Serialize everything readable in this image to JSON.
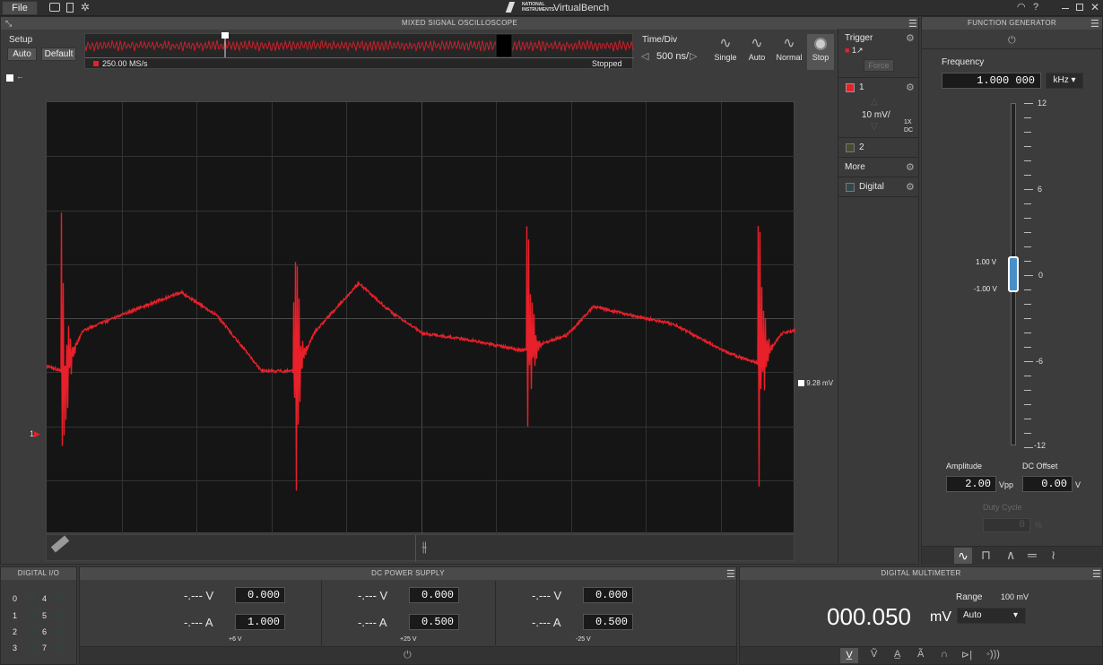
{
  "window": {
    "title": "VirtualBench",
    "brand": "NATIONAL INSTRUMENTS",
    "menu_file": "File"
  },
  "scope": {
    "header": "MIXED SIGNAL OSCILLOSCOPE",
    "setup_label": "Setup",
    "auto_label": "Auto",
    "default_label": "Default",
    "sample_rate": "250.00 MS/s",
    "state": "Stopped",
    "timediv_label": "Time/Div",
    "timediv_value": "500 ns/",
    "modes": [
      "Single",
      "Auto",
      "Normal",
      "Stop"
    ],
    "trigger_level": "9.28 mV",
    "channel_marker": "1"
  },
  "channels": {
    "trigger_label": "Trigger",
    "trigger_source": "1",
    "force_label": "Force",
    "ch1_label": "1",
    "ch1_scale": "10 mV/",
    "ch1_probe": "1X",
    "ch1_coupling": "DC",
    "ch2_label": "2",
    "more_label": "More",
    "digital_label": "Digital"
  },
  "fgen": {
    "header": "FUNCTION GENERATOR",
    "frequency_label": "Frequency",
    "frequency_value": "1.000 000",
    "frequency_unit": "kHz",
    "scale_labels": [
      "12",
      "6",
      "0",
      "-6",
      "-12"
    ],
    "high_label": "1.00 V",
    "low_label": "-1.00 V",
    "amplitude_label": "Amplitude",
    "amplitude_value": "2.00",
    "amplitude_unit": "Vpp",
    "offset_label": "DC Offset",
    "offset_value": "0.00",
    "offset_unit": "V",
    "duty_label": "Duty Cycle",
    "duty_value": "0",
    "duty_unit": "%"
  },
  "dio": {
    "header": "DIGITAL I/O",
    "lines": [
      "0",
      "4",
      "1",
      "5",
      "2",
      "6",
      "3",
      "7"
    ]
  },
  "psu": {
    "header": "DC POWER SUPPLY",
    "channels": [
      {
        "v_meas": "-.--- V",
        "v_set": "0.000",
        "a_meas": "-.--- A",
        "a_set": "1.000",
        "name": "+6 V"
      },
      {
        "v_meas": "-.--- V",
        "v_set": "0.000",
        "a_meas": "-.--- A",
        "a_set": "0.500",
        "name": "+25 V"
      },
      {
        "v_meas": "-.--- V",
        "v_set": "0.000",
        "a_meas": "-.--- A",
        "a_set": "0.500",
        "name": "-25 V"
      }
    ]
  },
  "dmm": {
    "header": "DIGITAL MULTIMETER",
    "range_label": "Range",
    "range_value": "100 mV",
    "reading": "000.050",
    "unit": "mV",
    "range_select": "Auto"
  },
  "colors": {
    "trace": "#e8202a",
    "accent": "#4a90c8"
  }
}
